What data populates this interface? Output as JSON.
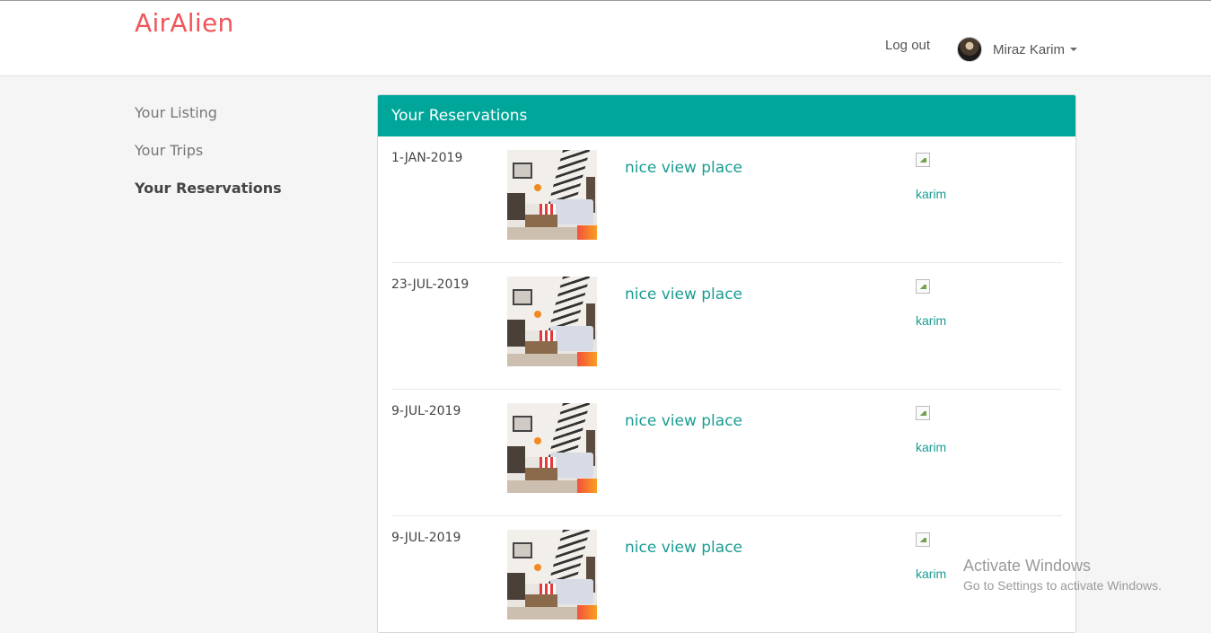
{
  "header": {
    "brand": "AirAlien",
    "logout_label": "Log out",
    "user_name": "Miraz Karim"
  },
  "sidebar": {
    "items": [
      {
        "label": "Your Listing",
        "active": false
      },
      {
        "label": "Your Trips",
        "active": false
      },
      {
        "label": "Your Reservations",
        "active": true
      }
    ]
  },
  "panel": {
    "title": "Your Reservations",
    "reservations": [
      {
        "date": "1-JAN-2019",
        "place": "nice view place",
        "host": "karim"
      },
      {
        "date": "23-JUL-2019",
        "place": "nice view place",
        "host": "karim"
      },
      {
        "date": "9-JUL-2019",
        "place": "nice view place",
        "host": "karim"
      },
      {
        "date": "9-JUL-2019",
        "place": "nice view place",
        "host": "karim"
      }
    ]
  },
  "watermark": {
    "line1": "Activate Windows",
    "line2": "Go to Settings to activate Windows."
  },
  "colors": {
    "brand": "#f0555a",
    "accent": "#00a699",
    "link": "#1a9c93"
  }
}
